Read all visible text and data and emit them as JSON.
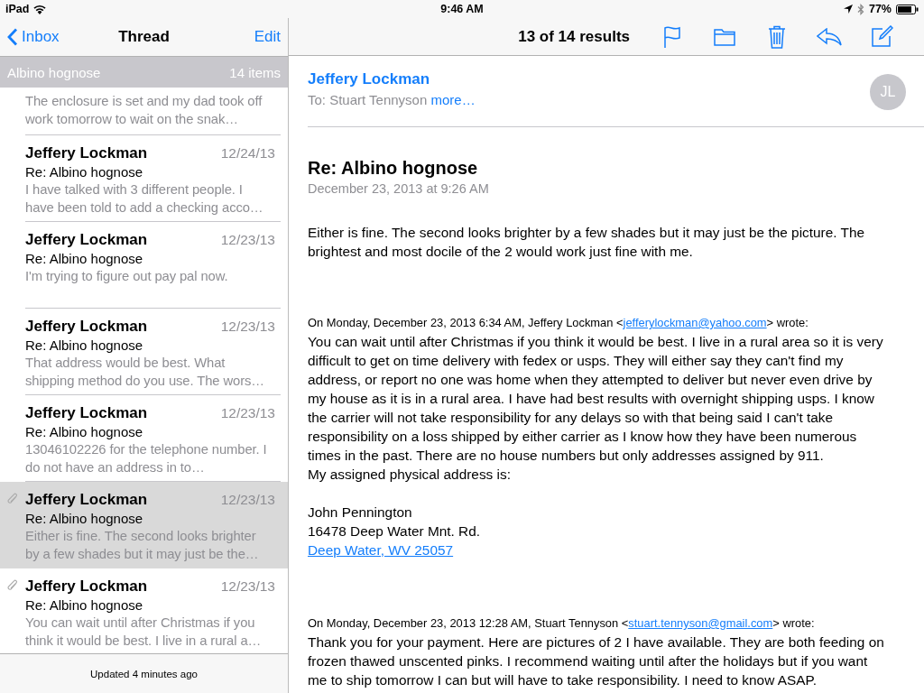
{
  "status_bar": {
    "device": "iPad",
    "time": "9:46 AM",
    "battery": "77%"
  },
  "sidebar": {
    "back": "Inbox",
    "title": "Thread",
    "edit": "Edit",
    "group": {
      "title": "Albino hognose",
      "count": "14 items"
    },
    "items": [
      {
        "preview": "The enclosure is set and my dad took off work tomorrow to wait on the snak…",
        "selected": false,
        "attachment": false
      },
      {
        "sender": "Jeffery Lockman",
        "date": "12/24/13",
        "subject": "Re: Albino hognose",
        "preview": "I have talked with 3 different people. I have been told to add a checking acco…",
        "selected": false,
        "attachment": false
      },
      {
        "sender": "Jeffery Lockman",
        "date": "12/23/13",
        "subject": "Re: Albino hognose",
        "preview": "I'm trying to figure out pay pal now.",
        "selected": false,
        "attachment": false
      },
      {
        "sender": "Jeffery Lockman",
        "date": "12/23/13",
        "subject": "Re: Albino hognose",
        "preview": "That address would be best. What shipping method do you use. The wors…",
        "selected": false,
        "attachment": false
      },
      {
        "sender": "Jeffery Lockman",
        "date": "12/23/13",
        "subject": "Re: Albino hognose",
        "preview": "13046102226 for the telephone number. I do not have an address in to…",
        "selected": false,
        "attachment": false
      },
      {
        "sender": "Jeffery Lockman",
        "date": "12/23/13",
        "subject": "Re: Albino hognose",
        "preview": "Either is fine. The second looks brighter by a few shades but it may just be the…",
        "selected": true,
        "attachment": true
      },
      {
        "sender": "Jeffery Lockman",
        "date": "12/23/13",
        "subject": "Re: Albino hognose",
        "preview": "You can wait until after Christmas if you think it would be best. I live in a rural a…",
        "selected": false,
        "attachment": true
      }
    ],
    "footer": "Updated 4 minutes ago"
  },
  "toolbar": {
    "results": "13 of 14 results"
  },
  "message": {
    "from": "Jeffery Lockman",
    "to_label": "To: Stuart Tennyson",
    "more": "more…",
    "initials": "JL",
    "subject": "Re: Albino hognose",
    "date": "December 23, 2013 at 9:26 AM",
    "body": "Either is fine. The second looks brighter by a few shades but it may just be the picture. The brightest and most docile of the 2 would work just fine with me.",
    "quotes": [
      {
        "prefix": "On Monday, December 23, 2013 6:34 AM, Jeffery Lockman <",
        "email": "jefferylockman@yahoo.com",
        "suffix": "> wrote:",
        "text": "You can wait until after Christmas if you think it would be best. I live in a rural area so it is very difficult to get on time delivery with fedex or usps. They will either say they can't find my address, or report no one was home when they attempted to deliver but never even drive by my house as it is in a rural area. I have had best results with overnight shipping usps. I know the carrier will not take responsibility for any delays so with that being said I can't take responsibility on a loss shipped by either carrier as I know how they have been numerous times in the past. There are no house numbers but only addresses assigned by 911.",
        "lines": [
          "My assigned physical address is:"
        ],
        "address": [
          "John Pennington",
          "16478 Deep Water Mnt. Rd."
        ],
        "address_link": "Deep Water, WV 25057"
      },
      {
        "prefix": "On Monday, December 23, 2013 12:28 AM, Stuart Tennyson <",
        "email": "stuart.tennyson@gmail.com",
        "suffix": "> wrote:",
        "text": "Thank you for your payment. Here are pictures of 2 I have available. They are both feeding on frozen thawed unscented pinks.  I recommend waiting until after the holidays but if you want me to ship tomorrow I can but will have to take responsibility. I need to know ASAP."
      }
    ]
  }
}
